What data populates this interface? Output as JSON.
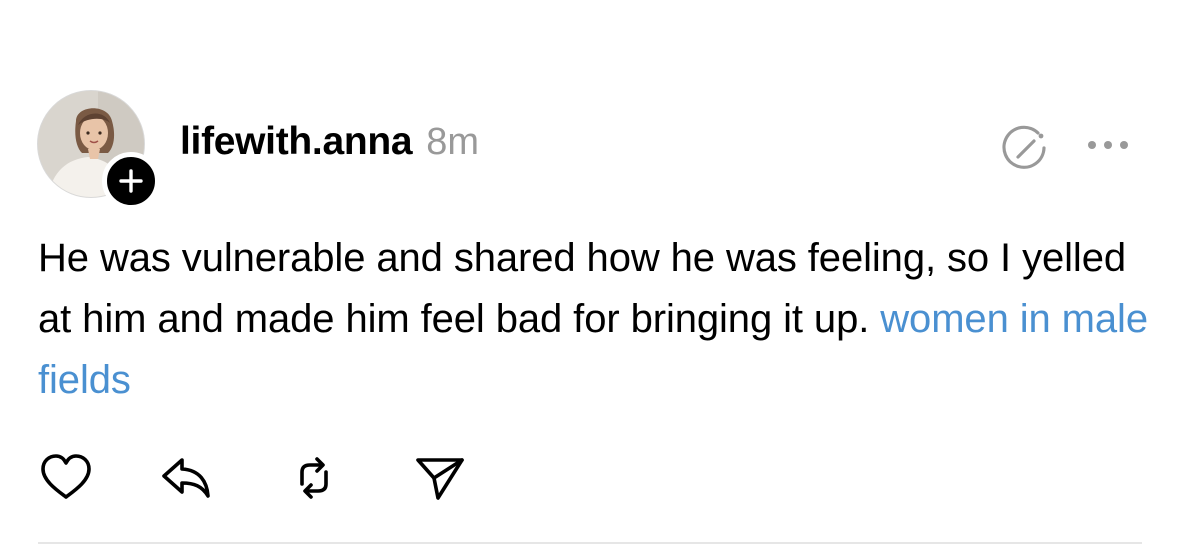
{
  "post": {
    "author": {
      "username": "lifewith.anna",
      "avatar_icon": "profile-photo",
      "follow_icon": "plus-icon"
    },
    "timestamp": "8m",
    "header_icons": [
      "author-reply-icon",
      "more-options-icon"
    ],
    "body_text": "He was vulnerable and shared how he was feeling, so I yelled at him and made him feel bad for bringing it up.",
    "topic_tag": "women in male fields",
    "topic_color": "#4a90d1",
    "actions": [
      {
        "name": "like",
        "icon": "heart-icon"
      },
      {
        "name": "reply",
        "icon": "reply-arrow-icon"
      },
      {
        "name": "repost",
        "icon": "repost-icon"
      },
      {
        "name": "share",
        "icon": "send-icon"
      }
    ]
  }
}
